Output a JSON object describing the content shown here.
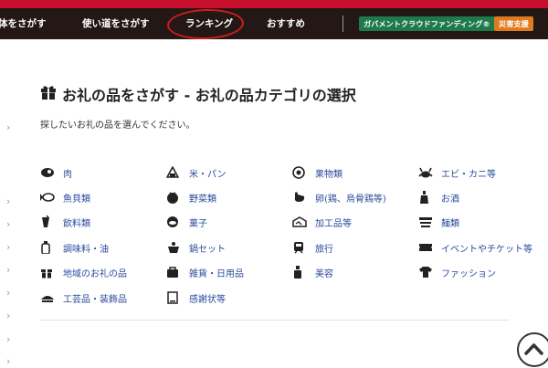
{
  "nav": {
    "items": [
      "体をさがす",
      "使い道をさがす",
      "ランキング",
      "おすすめ"
    ],
    "gov_button": "ガバメントクラウドファンディング®",
    "disaster_button": "災害支援"
  },
  "page": {
    "title": "お礼の品をさがす - お礼の品カテゴリの選択",
    "subtitle": "探したいお礼の品を選んでください。"
  },
  "categories": [
    {
      "label": "肉",
      "icon": "meat-icon"
    },
    {
      "label": "米・パン",
      "icon": "onigiri-icon"
    },
    {
      "label": "果物類",
      "icon": "fruit-icon"
    },
    {
      "label": "エビ・カニ等",
      "icon": "crab-icon"
    },
    {
      "label": "魚貝類",
      "icon": "fish-icon"
    },
    {
      "label": "野菜類",
      "icon": "tomato-icon"
    },
    {
      "label": "卵(鶏、烏骨鶏等)",
      "icon": "chicken-icon"
    },
    {
      "label": "お酒",
      "icon": "sake-icon"
    },
    {
      "label": "飲料類",
      "icon": "drink-icon"
    },
    {
      "label": "菓子",
      "icon": "sweets-icon"
    },
    {
      "label": "加工品等",
      "icon": "processed-food-icon"
    },
    {
      "label": "麺類",
      "icon": "noodle-icon"
    },
    {
      "label": "調味料・油",
      "icon": "seasoning-icon"
    },
    {
      "label": "鍋セット",
      "icon": "hotpot-icon"
    },
    {
      "label": "旅行",
      "icon": "train-icon"
    },
    {
      "label": "イベントやチケット等",
      "icon": "ticket-icon"
    },
    {
      "label": "地域のお礼の品",
      "icon": "gift-icon"
    },
    {
      "label": "雑貨・日用品",
      "icon": "bag-icon"
    },
    {
      "label": "美容",
      "icon": "cosmetics-icon"
    },
    {
      "label": "ファッション",
      "icon": "tshirt-icon"
    },
    {
      "label": "工芸品・装飾品",
      "icon": "craft-icon"
    },
    {
      "label": "感謝状等",
      "icon": "certificate-icon"
    }
  ],
  "colors": {
    "red_bar": "#c8102e",
    "nav_bg": "#231815",
    "gov_green": "#1f7a4b",
    "disaster_orange": "#e07a1f",
    "link_blue": "#2a4a9c",
    "annotation_red": "#d21b1b"
  }
}
